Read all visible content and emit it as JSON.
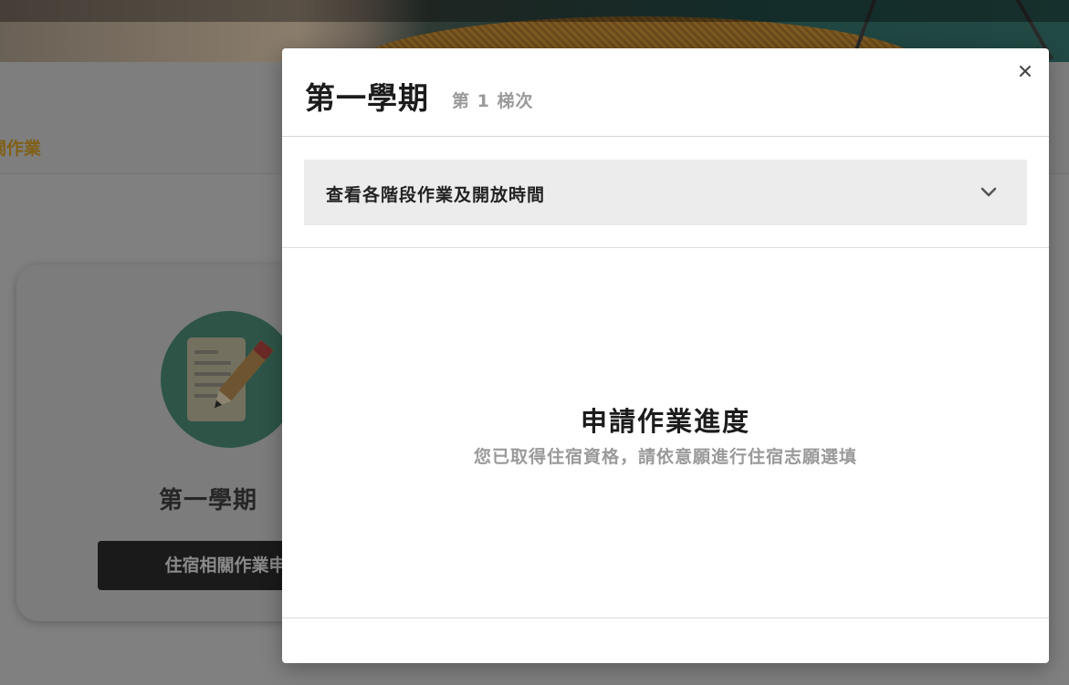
{
  "background_page": {
    "tab_label": "關作業",
    "card": {
      "icon": "document-pencil-icon",
      "title": "第一學期",
      "button_label": "住宿相關作業申"
    }
  },
  "modal": {
    "title": "第一學期",
    "subtitle": "第 1 梯次",
    "close_icon": "close-icon",
    "accordion": {
      "label": "查看各階段作業及開放時間",
      "icon": "chevron-down-icon",
      "expanded": false
    },
    "status": {
      "title": "申請作業進度",
      "description": "您已取得住宿資格，請依意願進行住宿志願選填"
    }
  },
  "colors": {
    "accent": "#e6a52a",
    "overlay": "rgba(0,0,0,0.5)",
    "card_icon_circle": "#5aa88e",
    "accordion_bg": "#ececec",
    "button_bg": "#333333"
  }
}
